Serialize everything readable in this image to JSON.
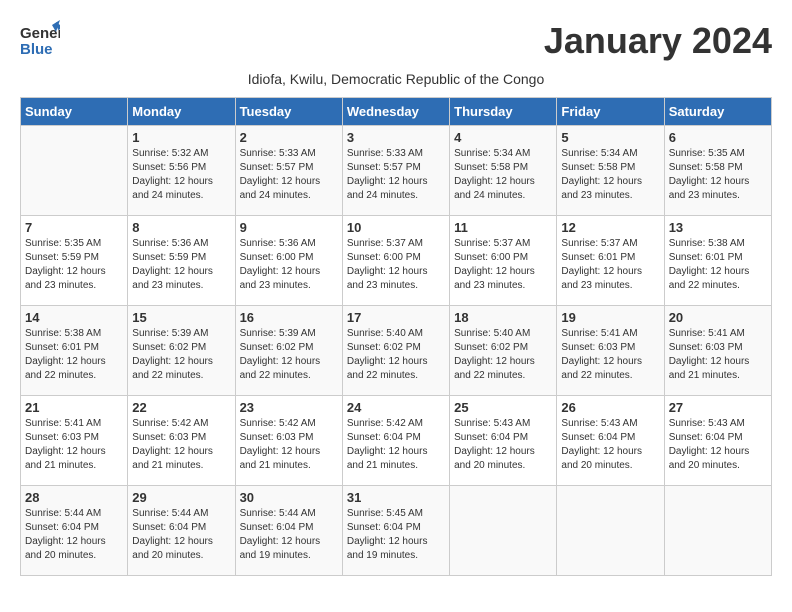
{
  "header": {
    "logo_general": "General",
    "logo_blue": "Blue",
    "month_title": "January 2024",
    "subtitle": "Idiofa, Kwilu, Democratic Republic of the Congo"
  },
  "columns": [
    "Sunday",
    "Monday",
    "Tuesday",
    "Wednesday",
    "Thursday",
    "Friday",
    "Saturday"
  ],
  "weeks": [
    [
      {
        "day": "",
        "info": ""
      },
      {
        "day": "1",
        "info": "Sunrise: 5:32 AM\nSunset: 5:56 PM\nDaylight: 12 hours\nand 24 minutes."
      },
      {
        "day": "2",
        "info": "Sunrise: 5:33 AM\nSunset: 5:57 PM\nDaylight: 12 hours\nand 24 minutes."
      },
      {
        "day": "3",
        "info": "Sunrise: 5:33 AM\nSunset: 5:57 PM\nDaylight: 12 hours\nand 24 minutes."
      },
      {
        "day": "4",
        "info": "Sunrise: 5:34 AM\nSunset: 5:58 PM\nDaylight: 12 hours\nand 24 minutes."
      },
      {
        "day": "5",
        "info": "Sunrise: 5:34 AM\nSunset: 5:58 PM\nDaylight: 12 hours\nand 23 minutes."
      },
      {
        "day": "6",
        "info": "Sunrise: 5:35 AM\nSunset: 5:58 PM\nDaylight: 12 hours\nand 23 minutes."
      }
    ],
    [
      {
        "day": "7",
        "info": "Sunrise: 5:35 AM\nSunset: 5:59 PM\nDaylight: 12 hours\nand 23 minutes."
      },
      {
        "day": "8",
        "info": "Sunrise: 5:36 AM\nSunset: 5:59 PM\nDaylight: 12 hours\nand 23 minutes."
      },
      {
        "day": "9",
        "info": "Sunrise: 5:36 AM\nSunset: 6:00 PM\nDaylight: 12 hours\nand 23 minutes."
      },
      {
        "day": "10",
        "info": "Sunrise: 5:37 AM\nSunset: 6:00 PM\nDaylight: 12 hours\nand 23 minutes."
      },
      {
        "day": "11",
        "info": "Sunrise: 5:37 AM\nSunset: 6:00 PM\nDaylight: 12 hours\nand 23 minutes."
      },
      {
        "day": "12",
        "info": "Sunrise: 5:37 AM\nSunset: 6:01 PM\nDaylight: 12 hours\nand 23 minutes."
      },
      {
        "day": "13",
        "info": "Sunrise: 5:38 AM\nSunset: 6:01 PM\nDaylight: 12 hours\nand 22 minutes."
      }
    ],
    [
      {
        "day": "14",
        "info": "Sunrise: 5:38 AM\nSunset: 6:01 PM\nDaylight: 12 hours\nand 22 minutes."
      },
      {
        "day": "15",
        "info": "Sunrise: 5:39 AM\nSunset: 6:02 PM\nDaylight: 12 hours\nand 22 minutes."
      },
      {
        "day": "16",
        "info": "Sunrise: 5:39 AM\nSunset: 6:02 PM\nDaylight: 12 hours\nand 22 minutes."
      },
      {
        "day": "17",
        "info": "Sunrise: 5:40 AM\nSunset: 6:02 PM\nDaylight: 12 hours\nand 22 minutes."
      },
      {
        "day": "18",
        "info": "Sunrise: 5:40 AM\nSunset: 6:02 PM\nDaylight: 12 hours\nand 22 minutes."
      },
      {
        "day": "19",
        "info": "Sunrise: 5:41 AM\nSunset: 6:03 PM\nDaylight: 12 hours\nand 22 minutes."
      },
      {
        "day": "20",
        "info": "Sunrise: 5:41 AM\nSunset: 6:03 PM\nDaylight: 12 hours\nand 21 minutes."
      }
    ],
    [
      {
        "day": "21",
        "info": "Sunrise: 5:41 AM\nSunset: 6:03 PM\nDaylight: 12 hours\nand 21 minutes."
      },
      {
        "day": "22",
        "info": "Sunrise: 5:42 AM\nSunset: 6:03 PM\nDaylight: 12 hours\nand 21 minutes."
      },
      {
        "day": "23",
        "info": "Sunrise: 5:42 AM\nSunset: 6:03 PM\nDaylight: 12 hours\nand 21 minutes."
      },
      {
        "day": "24",
        "info": "Sunrise: 5:42 AM\nSunset: 6:04 PM\nDaylight: 12 hours\nand 21 minutes."
      },
      {
        "day": "25",
        "info": "Sunrise: 5:43 AM\nSunset: 6:04 PM\nDaylight: 12 hours\nand 20 minutes."
      },
      {
        "day": "26",
        "info": "Sunrise: 5:43 AM\nSunset: 6:04 PM\nDaylight: 12 hours\nand 20 minutes."
      },
      {
        "day": "27",
        "info": "Sunrise: 5:43 AM\nSunset: 6:04 PM\nDaylight: 12 hours\nand 20 minutes."
      }
    ],
    [
      {
        "day": "28",
        "info": "Sunrise: 5:44 AM\nSunset: 6:04 PM\nDaylight: 12 hours\nand 20 minutes."
      },
      {
        "day": "29",
        "info": "Sunrise: 5:44 AM\nSunset: 6:04 PM\nDaylight: 12 hours\nand 20 minutes."
      },
      {
        "day": "30",
        "info": "Sunrise: 5:44 AM\nSunset: 6:04 PM\nDaylight: 12 hours\nand 19 minutes."
      },
      {
        "day": "31",
        "info": "Sunrise: 5:45 AM\nSunset: 6:04 PM\nDaylight: 12 hours\nand 19 minutes."
      },
      {
        "day": "",
        "info": ""
      },
      {
        "day": "",
        "info": ""
      },
      {
        "day": "",
        "info": ""
      }
    ]
  ]
}
